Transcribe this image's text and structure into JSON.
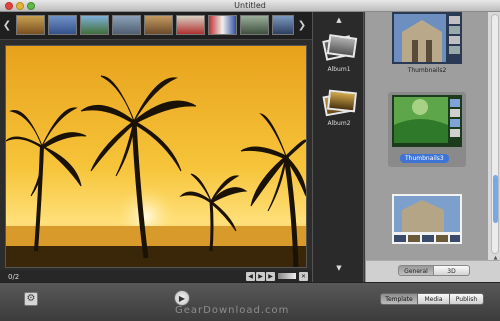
{
  "window": {
    "title": "Untitled"
  },
  "filmstrip": {
    "thumbnails": [
      "thumb-1",
      "thumb-2",
      "thumb-3",
      "thumb-4",
      "thumb-5",
      "thumb-6",
      "thumb-7",
      "thumb-8",
      "thumb-9"
    ]
  },
  "viewer": {
    "counter": "0/2"
  },
  "albums": {
    "items": [
      {
        "label": "Album1"
      },
      {
        "label": "Album2"
      }
    ]
  },
  "templates": {
    "items": [
      {
        "label": "Thumbnails2"
      },
      {
        "label": "Thumbnails3",
        "selected": true
      },
      {
        "label": ""
      }
    ]
  },
  "right_segments": {
    "general_label": "General",
    "threed_label": "3D"
  },
  "bottom_tabs": {
    "template_label": "Template",
    "media_label": "Media",
    "publish_label": "Publish"
  },
  "watermark": "GearDownload.com",
  "colors": {
    "selection_blue": "#3d74d6",
    "scroll_thumb": "#7aa7e6"
  }
}
